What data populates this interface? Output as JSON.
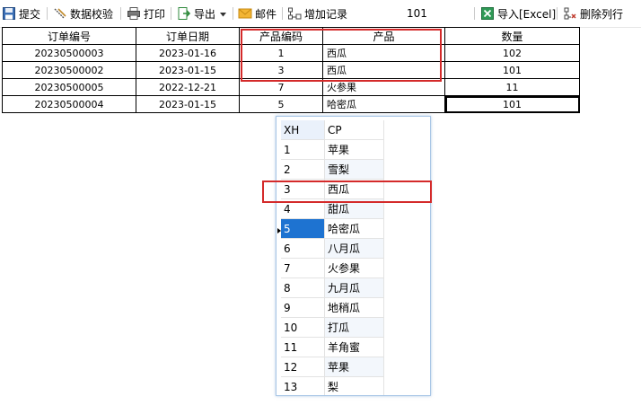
{
  "toolbar": {
    "submit_label": "提交",
    "validate_label": "数据校验",
    "print_label": "打印",
    "export_label": "导出",
    "mail_label": "邮件",
    "add_record_label": "增加记录",
    "record_count": "101",
    "import_label": "导入[Excel]",
    "delete_row_label": "删除列行"
  },
  "grid": {
    "columns": [
      "订单编号",
      "订单日期",
      "产品编码",
      "产品",
      "数量"
    ],
    "rows": [
      {
        "order_no": "20230500003",
        "date": "2023-01-16",
        "code": "1",
        "product": "西瓜",
        "qty": "102"
      },
      {
        "order_no": "20230500002",
        "date": "2023-01-15",
        "code": "3",
        "product": "西瓜",
        "qty": "101"
      },
      {
        "order_no": "20230500005",
        "date": "2022-12-21",
        "code": "7",
        "product": "火参果",
        "qty": "11"
      },
      {
        "order_no": "20230500004",
        "date": "2023-01-15",
        "code": "5",
        "product": "哈密瓜",
        "qty": "101"
      }
    ]
  },
  "dropdown": {
    "headers": {
      "xh": "XH",
      "cp": "CP"
    },
    "items": [
      {
        "xh": "1",
        "cp": "苹果"
      },
      {
        "xh": "2",
        "cp": "雪梨"
      },
      {
        "xh": "3",
        "cp": "西瓜"
      },
      {
        "xh": "4",
        "cp": "甜瓜"
      },
      {
        "xh": "5",
        "cp": "哈密瓜"
      },
      {
        "xh": "6",
        "cp": "八月瓜"
      },
      {
        "xh": "7",
        "cp": "火参果"
      },
      {
        "xh": "8",
        "cp": "九月瓜"
      },
      {
        "xh": "9",
        "cp": "地稍瓜"
      },
      {
        "xh": "10",
        "cp": "打瓜"
      },
      {
        "xh": "11",
        "cp": "羊角蜜"
      },
      {
        "xh": "12",
        "cp": "苹果"
      },
      {
        "xh": "13",
        "cp": "梨"
      }
    ],
    "active_xh": "5"
  },
  "colors": {
    "highlight_red": "#d42a2a",
    "selection_blue": "#1e73d1"
  }
}
